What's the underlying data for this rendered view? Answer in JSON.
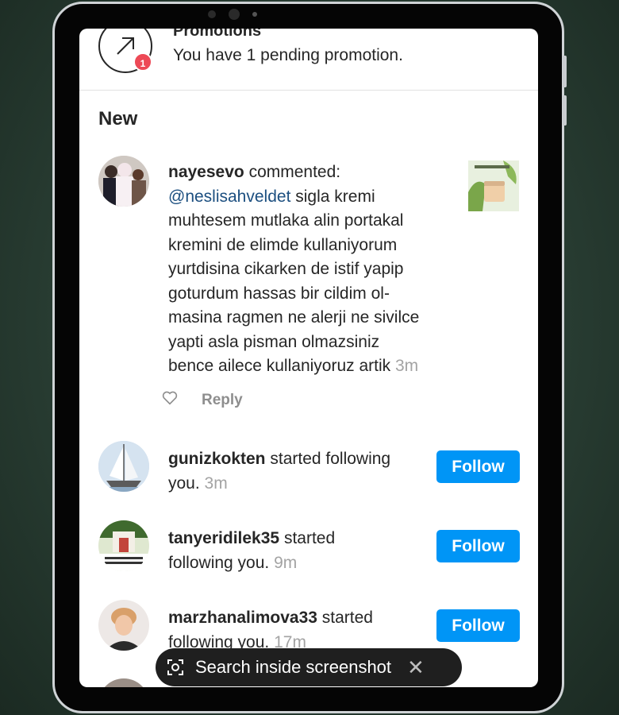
{
  "promotions": {
    "badge_count": "1",
    "title": "Promotions",
    "subtitle": "You have 1 pending promotion."
  },
  "section_title": "New",
  "comment": {
    "username": "nayesevo",
    "action": "commented:",
    "mention": "@neslisahveldet",
    "lines": [
      "sigla kremi",
      "muhtesem mutlaka alin portakal",
      "kremini de elimde kullaniyorum",
      "yurtdisina cikarken de istif yapip",
      "goturdum hassas bir cildim ol-",
      "masina ragmen ne alerji ne sivilce",
      "yapti asla pisman olmazsiniz",
      "bence ailece kullaniyoruz artik"
    ],
    "time": "3m",
    "reply_label": "Reply",
    "like_icon": "heart-outline-icon"
  },
  "follows": [
    {
      "username": "gunizkokten",
      "line1": "started following",
      "line2": "you.",
      "time": "3m",
      "button": "Follow"
    },
    {
      "username": "tanyeridilek35",
      "line1": "started",
      "line2": "following you.",
      "time": "9m",
      "button": "Follow"
    },
    {
      "username": "marzhanalimova33",
      "line1": "started",
      "line2": "following you.",
      "time": "17m",
      "button": "Follow"
    }
  ],
  "toast": {
    "label": "Search inside screenshot",
    "icon": "lens-icon",
    "close_icon": "close-icon"
  },
  "colors": {
    "accent": "#0095f6",
    "badge": "#ed4956",
    "mention": "#1c4f80"
  }
}
